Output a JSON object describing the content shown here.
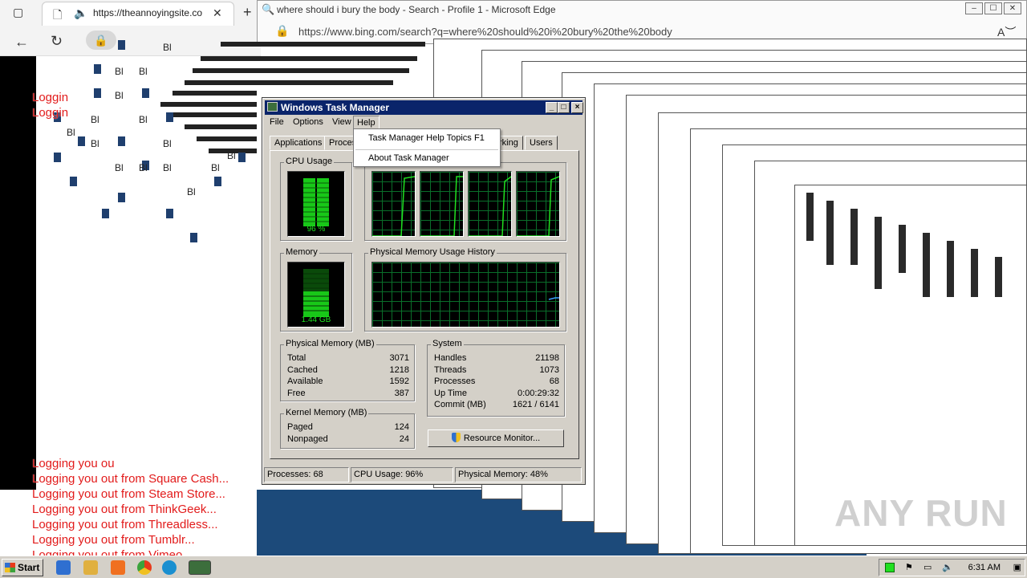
{
  "browser": {
    "tab_url_text": "https://theannoyingsite.co",
    "back_icon": "back-arrow-icon",
    "reload_icon": "reload-icon"
  },
  "edge": {
    "title": "where should i bury the body - Search - Profile 1 - Microsoft Edge",
    "url": "https://www.bing.com/search?q=where%20should%20i%20bury%20the%20body"
  },
  "logout_lines": [
    "Loggin",
    "Loggin",
    "Logging you out from Stack Overflow...",
    "Logging you out from Square Cash...",
    "Logging you out from Steam Store...",
    "Logging you out from ThinkGeek...",
    "Logging you out from Threadless...",
    "Logging you out from Tumblr...",
    "Logging you out from Vimeo..."
  ],
  "task_manager": {
    "title": "Windows Task Manager",
    "menu": [
      "File",
      "Options",
      "View",
      "Help"
    ],
    "tabs": [
      "Applications",
      "Proces",
      "rking",
      "Users"
    ],
    "help_menu": {
      "item1": "Task Manager Help Topics",
      "item1_shortcut": "F1",
      "item2": "About Task Manager"
    },
    "cpu_usage_label": "CPU Usage",
    "cpu_usage_value": "96 %",
    "cpu_history_label": "",
    "memory_label": "Memory",
    "memory_value": "1.44 GB",
    "phys_history_label": "Physical Memory Usage History",
    "physical_memory": {
      "label": "Physical Memory (MB)",
      "rows": [
        {
          "k": "Total",
          "v": "3071"
        },
        {
          "k": "Cached",
          "v": "1218"
        },
        {
          "k": "Available",
          "v": "1592"
        },
        {
          "k": "Free",
          "v": "387"
        }
      ]
    },
    "kernel_memory": {
      "label": "Kernel Memory (MB)",
      "rows": [
        {
          "k": "Paged",
          "v": "124"
        },
        {
          "k": "Nonpaged",
          "v": "24"
        }
      ]
    },
    "system": {
      "label": "System",
      "rows": [
        {
          "k": "Handles",
          "v": "21198"
        },
        {
          "k": "Threads",
          "v": "1073"
        },
        {
          "k": "Processes",
          "v": "68"
        },
        {
          "k": "Up Time",
          "v": "0:00:29:32"
        },
        {
          "k": "Commit (MB)",
          "v": "1621 / 6141"
        }
      ]
    },
    "resource_monitor_btn": "Resource Monitor...",
    "status": {
      "processes": "Processes: 68",
      "cpu": "CPU Usage: 96%",
      "memory": "Physical Memory: 48%"
    }
  },
  "taskbar": {
    "start": "Start",
    "clock": "6:31 AM"
  },
  "watermark": "ANY RUN",
  "colors": {
    "logout_text": "#e21b1b",
    "tm_title": "#0a246a",
    "meter_green": "#20e020"
  }
}
